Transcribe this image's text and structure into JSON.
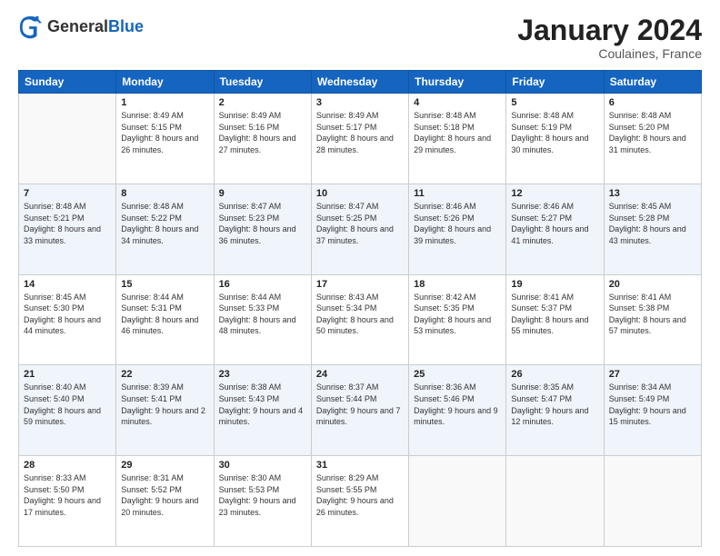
{
  "logo": {
    "general": "General",
    "blue": "Blue"
  },
  "header": {
    "month": "January 2024",
    "location": "Coulaines, France"
  },
  "weekdays": [
    "Sunday",
    "Monday",
    "Tuesday",
    "Wednesday",
    "Thursday",
    "Friday",
    "Saturday"
  ],
  "weeks": [
    [
      {
        "day": "",
        "sunrise": "",
        "sunset": "",
        "daylight": ""
      },
      {
        "day": "1",
        "sunrise": "Sunrise: 8:49 AM",
        "sunset": "Sunset: 5:15 PM",
        "daylight": "Daylight: 8 hours and 26 minutes."
      },
      {
        "day": "2",
        "sunrise": "Sunrise: 8:49 AM",
        "sunset": "Sunset: 5:16 PM",
        "daylight": "Daylight: 8 hours and 27 minutes."
      },
      {
        "day": "3",
        "sunrise": "Sunrise: 8:49 AM",
        "sunset": "Sunset: 5:17 PM",
        "daylight": "Daylight: 8 hours and 28 minutes."
      },
      {
        "day": "4",
        "sunrise": "Sunrise: 8:48 AM",
        "sunset": "Sunset: 5:18 PM",
        "daylight": "Daylight: 8 hours and 29 minutes."
      },
      {
        "day": "5",
        "sunrise": "Sunrise: 8:48 AM",
        "sunset": "Sunset: 5:19 PM",
        "daylight": "Daylight: 8 hours and 30 minutes."
      },
      {
        "day": "6",
        "sunrise": "Sunrise: 8:48 AM",
        "sunset": "Sunset: 5:20 PM",
        "daylight": "Daylight: 8 hours and 31 minutes."
      }
    ],
    [
      {
        "day": "7",
        "sunrise": "Sunrise: 8:48 AM",
        "sunset": "Sunset: 5:21 PM",
        "daylight": "Daylight: 8 hours and 33 minutes."
      },
      {
        "day": "8",
        "sunrise": "Sunrise: 8:48 AM",
        "sunset": "Sunset: 5:22 PM",
        "daylight": "Daylight: 8 hours and 34 minutes."
      },
      {
        "day": "9",
        "sunrise": "Sunrise: 8:47 AM",
        "sunset": "Sunset: 5:23 PM",
        "daylight": "Daylight: 8 hours and 36 minutes."
      },
      {
        "day": "10",
        "sunrise": "Sunrise: 8:47 AM",
        "sunset": "Sunset: 5:25 PM",
        "daylight": "Daylight: 8 hours and 37 minutes."
      },
      {
        "day": "11",
        "sunrise": "Sunrise: 8:46 AM",
        "sunset": "Sunset: 5:26 PM",
        "daylight": "Daylight: 8 hours and 39 minutes."
      },
      {
        "day": "12",
        "sunrise": "Sunrise: 8:46 AM",
        "sunset": "Sunset: 5:27 PM",
        "daylight": "Daylight: 8 hours and 41 minutes."
      },
      {
        "day": "13",
        "sunrise": "Sunrise: 8:45 AM",
        "sunset": "Sunset: 5:28 PM",
        "daylight": "Daylight: 8 hours and 43 minutes."
      }
    ],
    [
      {
        "day": "14",
        "sunrise": "Sunrise: 8:45 AM",
        "sunset": "Sunset: 5:30 PM",
        "daylight": "Daylight: 8 hours and 44 minutes."
      },
      {
        "day": "15",
        "sunrise": "Sunrise: 8:44 AM",
        "sunset": "Sunset: 5:31 PM",
        "daylight": "Daylight: 8 hours and 46 minutes."
      },
      {
        "day": "16",
        "sunrise": "Sunrise: 8:44 AM",
        "sunset": "Sunset: 5:33 PM",
        "daylight": "Daylight: 8 hours and 48 minutes."
      },
      {
        "day": "17",
        "sunrise": "Sunrise: 8:43 AM",
        "sunset": "Sunset: 5:34 PM",
        "daylight": "Daylight: 8 hours and 50 minutes."
      },
      {
        "day": "18",
        "sunrise": "Sunrise: 8:42 AM",
        "sunset": "Sunset: 5:35 PM",
        "daylight": "Daylight: 8 hours and 53 minutes."
      },
      {
        "day": "19",
        "sunrise": "Sunrise: 8:41 AM",
        "sunset": "Sunset: 5:37 PM",
        "daylight": "Daylight: 8 hours and 55 minutes."
      },
      {
        "day": "20",
        "sunrise": "Sunrise: 8:41 AM",
        "sunset": "Sunset: 5:38 PM",
        "daylight": "Daylight: 8 hours and 57 minutes."
      }
    ],
    [
      {
        "day": "21",
        "sunrise": "Sunrise: 8:40 AM",
        "sunset": "Sunset: 5:40 PM",
        "daylight": "Daylight: 8 hours and 59 minutes."
      },
      {
        "day": "22",
        "sunrise": "Sunrise: 8:39 AM",
        "sunset": "Sunset: 5:41 PM",
        "daylight": "Daylight: 9 hours and 2 minutes."
      },
      {
        "day": "23",
        "sunrise": "Sunrise: 8:38 AM",
        "sunset": "Sunset: 5:43 PM",
        "daylight": "Daylight: 9 hours and 4 minutes."
      },
      {
        "day": "24",
        "sunrise": "Sunrise: 8:37 AM",
        "sunset": "Sunset: 5:44 PM",
        "daylight": "Daylight: 9 hours and 7 minutes."
      },
      {
        "day": "25",
        "sunrise": "Sunrise: 8:36 AM",
        "sunset": "Sunset: 5:46 PM",
        "daylight": "Daylight: 9 hours and 9 minutes."
      },
      {
        "day": "26",
        "sunrise": "Sunrise: 8:35 AM",
        "sunset": "Sunset: 5:47 PM",
        "daylight": "Daylight: 9 hours and 12 minutes."
      },
      {
        "day": "27",
        "sunrise": "Sunrise: 8:34 AM",
        "sunset": "Sunset: 5:49 PM",
        "daylight": "Daylight: 9 hours and 15 minutes."
      }
    ],
    [
      {
        "day": "28",
        "sunrise": "Sunrise: 8:33 AM",
        "sunset": "Sunset: 5:50 PM",
        "daylight": "Daylight: 9 hours and 17 minutes."
      },
      {
        "day": "29",
        "sunrise": "Sunrise: 8:31 AM",
        "sunset": "Sunset: 5:52 PM",
        "daylight": "Daylight: 9 hours and 20 minutes."
      },
      {
        "day": "30",
        "sunrise": "Sunrise: 8:30 AM",
        "sunset": "Sunset: 5:53 PM",
        "daylight": "Daylight: 9 hours and 23 minutes."
      },
      {
        "day": "31",
        "sunrise": "Sunrise: 8:29 AM",
        "sunset": "Sunset: 5:55 PM",
        "daylight": "Daylight: 9 hours and 26 minutes."
      },
      {
        "day": "",
        "sunrise": "",
        "sunset": "",
        "daylight": ""
      },
      {
        "day": "",
        "sunrise": "",
        "sunset": "",
        "daylight": ""
      },
      {
        "day": "",
        "sunrise": "",
        "sunset": "",
        "daylight": ""
      }
    ]
  ]
}
